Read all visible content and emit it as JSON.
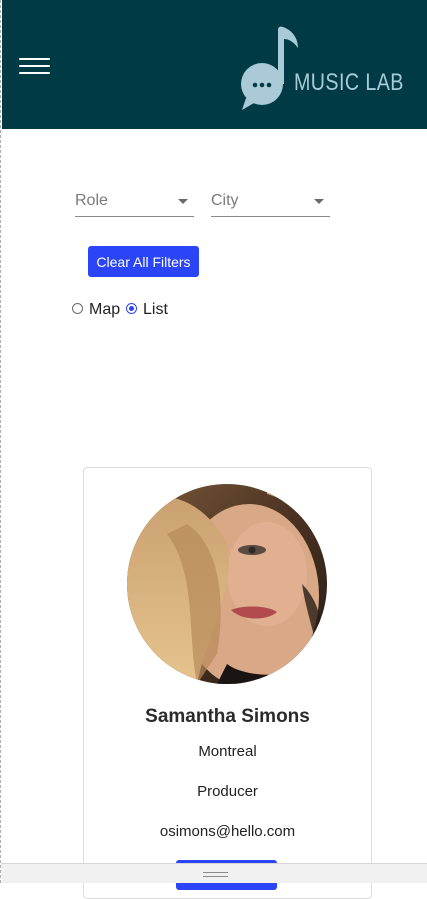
{
  "header": {
    "brand_text": "MUSIC LAB",
    "menu_icon": "hamburger-menu-icon",
    "logo_icon": "music-note-chat-icon",
    "background": "#003b45",
    "logo_color": "#a9cad6"
  },
  "filters": {
    "role_label": "Role",
    "city_label": "City",
    "clear_label": "Clear All Filters",
    "view_options": [
      "Map",
      "List"
    ],
    "selected_view": "List"
  },
  "profile_card": {
    "name": "Samantha Simons",
    "city": "Montreal",
    "role": "Producer",
    "email": "osimons@hello.com"
  },
  "colors": {
    "accent": "#2b45f6"
  }
}
